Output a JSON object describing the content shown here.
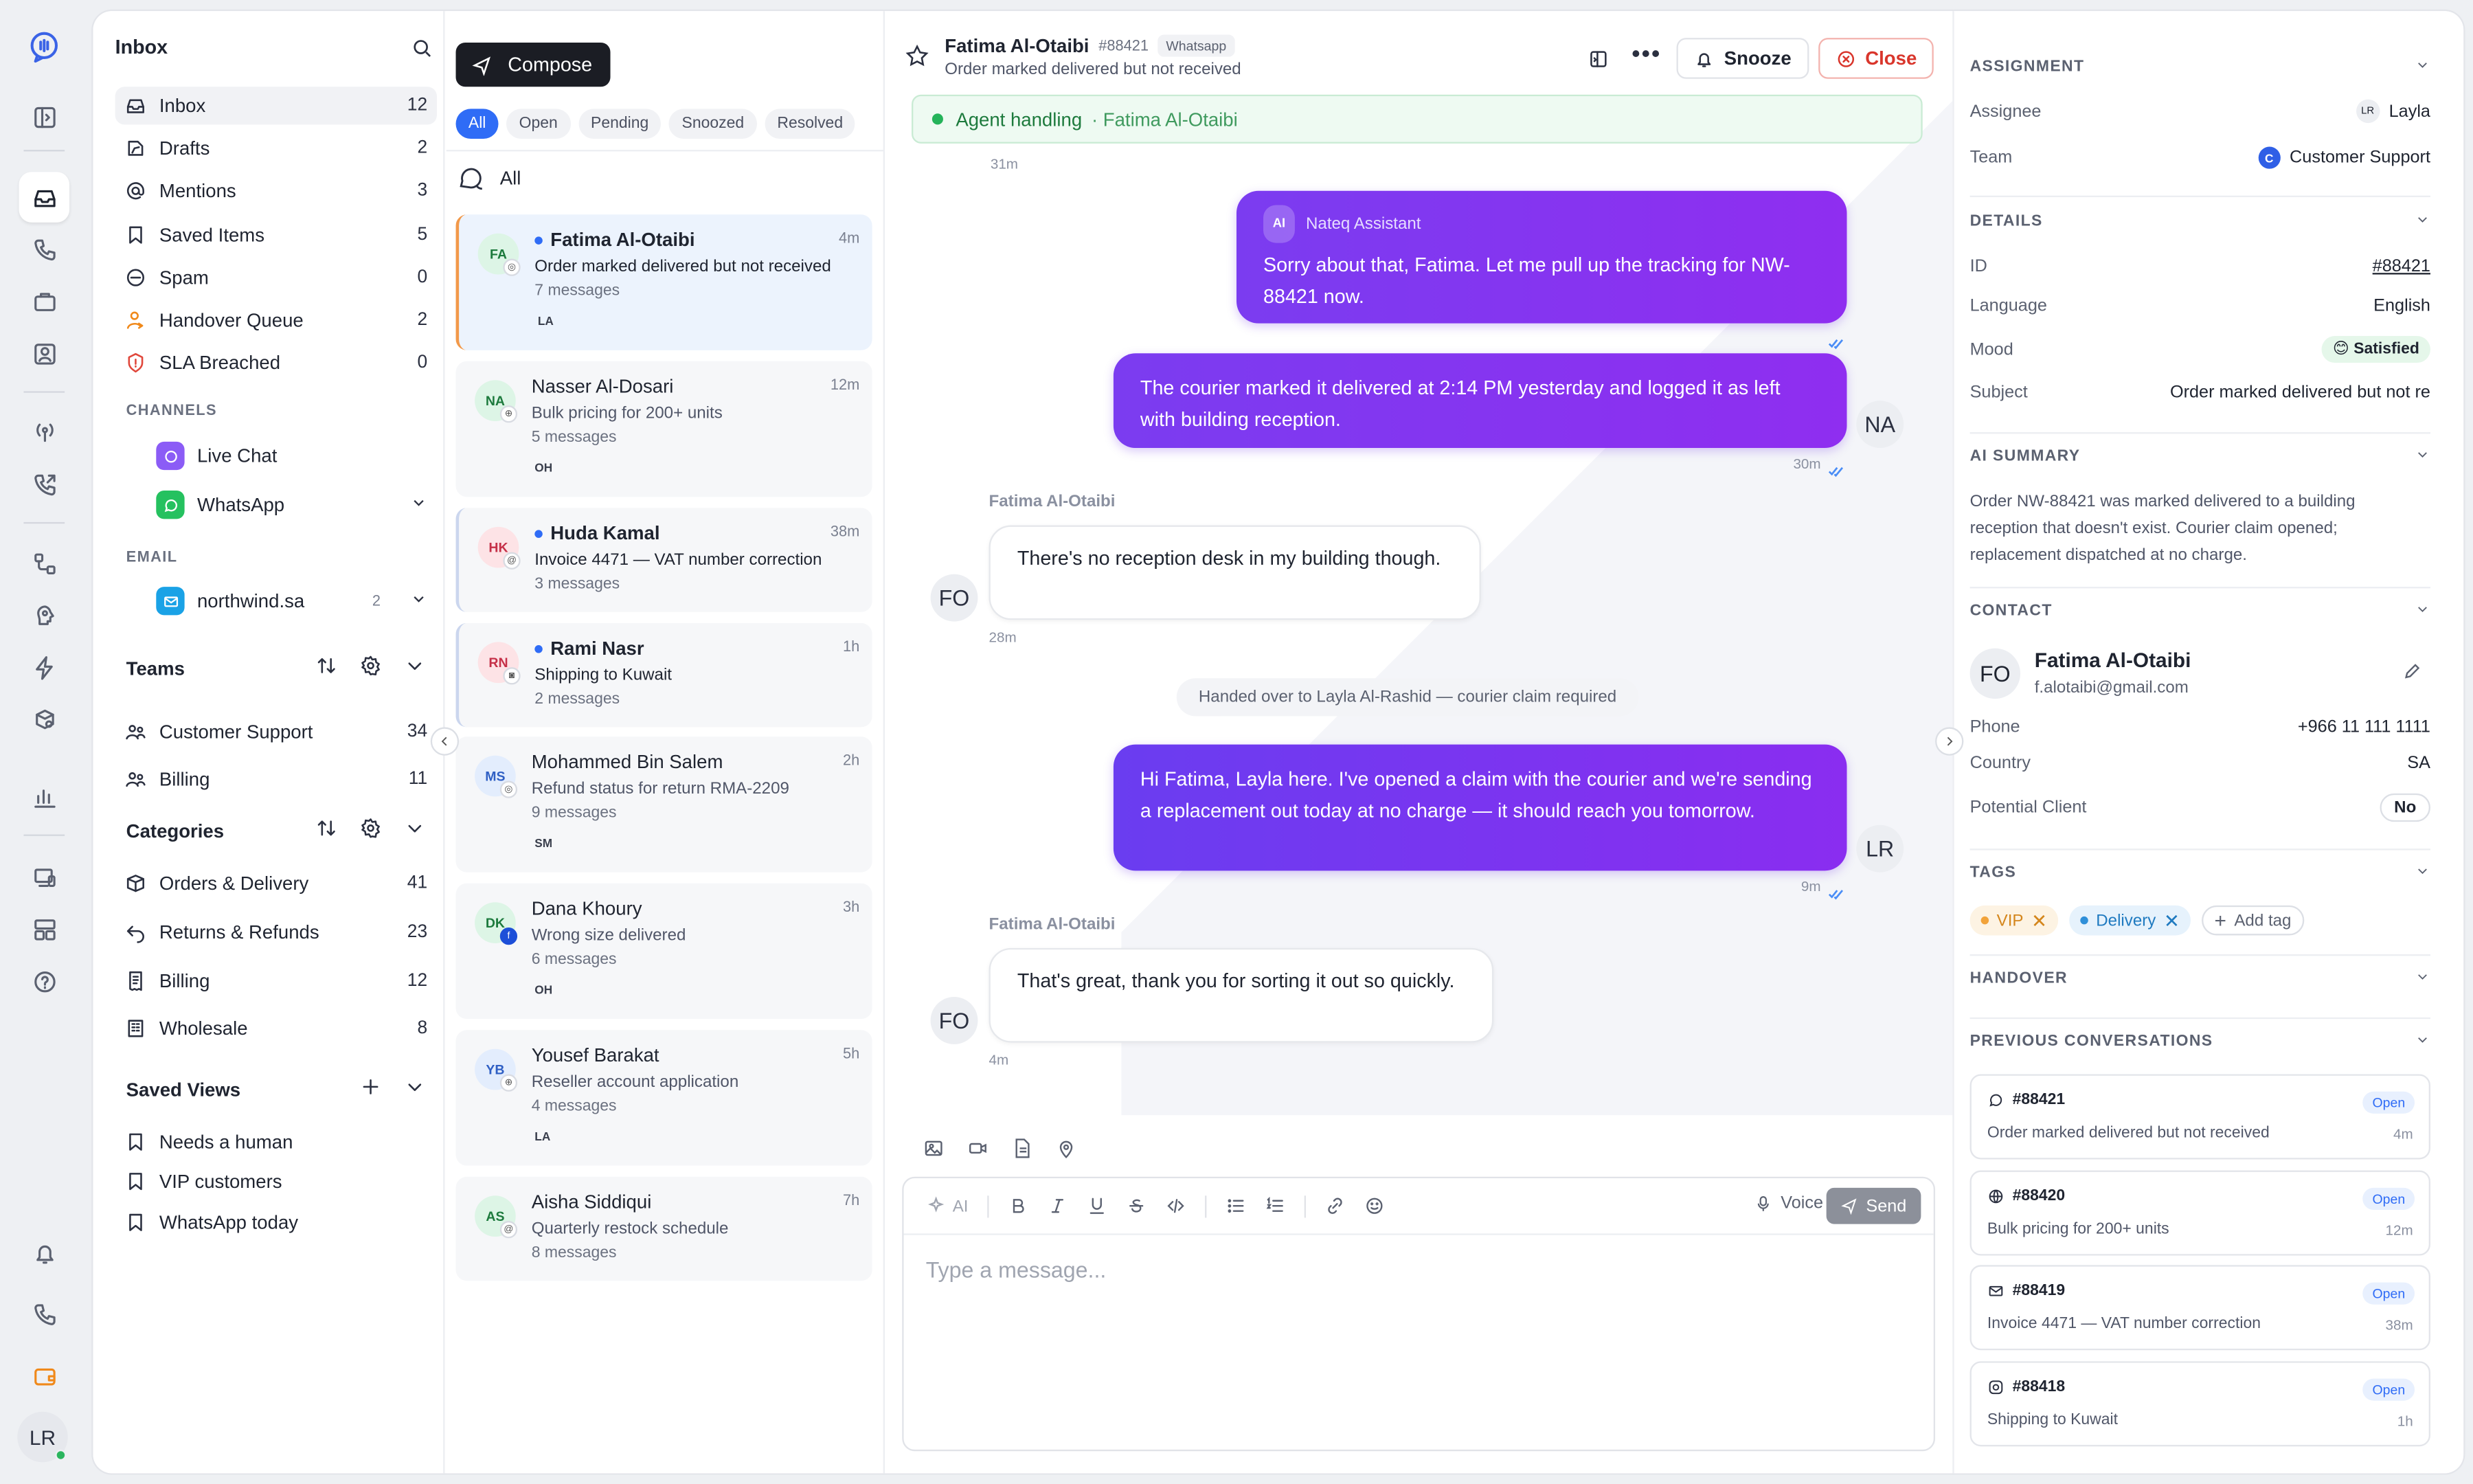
{
  "rail": {
    "avatar": "LR"
  },
  "sidebar": {
    "title": "Inbox",
    "items": [
      {
        "label": "Inbox",
        "count": "12"
      },
      {
        "label": "Drafts",
        "count": "2"
      },
      {
        "label": "Mentions",
        "count": "3"
      },
      {
        "label": "Saved Items",
        "count": "5"
      },
      {
        "label": "Spam",
        "count": "0"
      },
      {
        "label": "Handover Queue",
        "count": "2"
      },
      {
        "label": "SLA Breached",
        "count": "0"
      }
    ],
    "channels_title": "CHANNELS",
    "channels": [
      {
        "label": "Live Chat"
      },
      {
        "label": "WhatsApp"
      }
    ],
    "email_title": "EMAIL",
    "email": {
      "label": "northwind.sa",
      "count": "2"
    },
    "teams_title": "Teams",
    "teams": [
      {
        "label": "Customer Support",
        "count": "34"
      },
      {
        "label": "Billing",
        "count": "11"
      }
    ],
    "categories_title": "Categories",
    "categories": [
      {
        "label": "Orders & Delivery",
        "count": "41"
      },
      {
        "label": "Returns & Refunds",
        "count": "23"
      },
      {
        "label": "Billing",
        "count": "12"
      },
      {
        "label": "Wholesale",
        "count": "8"
      }
    ],
    "views_title": "Saved Views",
    "views": [
      {
        "label": "Needs a human"
      },
      {
        "label": "VIP customers"
      },
      {
        "label": "WhatsApp today"
      }
    ]
  },
  "list": {
    "compose": "Compose",
    "filters": [
      "All",
      "Open",
      "Pending",
      "Snoozed",
      "Resolved"
    ],
    "all_label": "All",
    "conversations": [
      {
        "initials": "FA",
        "name": "Fatima Al-Otaibi",
        "time": "4m",
        "subject": "Order marked delivered but not received",
        "messages": "7 messages",
        "assignee": "LA"
      },
      {
        "initials": "NA",
        "name": "Nasser Al-Dosari",
        "time": "12m",
        "subject": "Bulk pricing for 200+ units",
        "messages": "5 messages",
        "assignee": "OH"
      },
      {
        "initials": "HK",
        "name": "Huda Kamal",
        "time": "38m",
        "subject": "Invoice 4471 — VAT number correction",
        "messages": "3 messages",
        "assignee": ""
      },
      {
        "initials": "RN",
        "name": "Rami Nasr",
        "time": "1h",
        "subject": "Shipping to Kuwait",
        "messages": "2 messages",
        "assignee": ""
      },
      {
        "initials": "MS",
        "name": "Mohammed Bin Salem",
        "time": "2h",
        "subject": "Refund status for return RMA-2209",
        "messages": "9 messages",
        "assignee": "SM"
      },
      {
        "initials": "DK",
        "name": "Dana Khoury",
        "time": "3h",
        "subject": "Wrong size delivered",
        "messages": "6 messages",
        "assignee": "OH"
      },
      {
        "initials": "YB",
        "name": "Yousef Barakat",
        "time": "5h",
        "subject": "Reseller account application",
        "messages": "4 messages",
        "assignee": "LA"
      },
      {
        "initials": "AS",
        "name": "Aisha Siddiqui",
        "time": "7h",
        "subject": "Quarterly restock schedule",
        "messages": "8 messages",
        "assignee": ""
      }
    ]
  },
  "conversation": {
    "name": "Fatima Al-Otaibi",
    "id": "#88421",
    "channel": "Whatsapp",
    "subject": "Order marked delivered but not received",
    "snooze": "Snooze",
    "close": "Close",
    "agent_status": "Agent handling",
    "agent_name": "· Fatima Al-Otaibi",
    "messages": {
      "t0": "31m",
      "ai_label": "Nateq Assistant",
      "ai_pill": "AI",
      "ai_text": "Sorry about that, Fatima. Let me pull up the tracking for NW-88421 now.",
      "m2_text": "The courier marked it delivered at 2:14 PM yesterday and logged it as left with building reception.",
      "m2_avatar": "NA",
      "m2_time": "30m",
      "in1_sender": "Fatima Al-Otaibi",
      "in1_text": "There's no reception desk in my building though.",
      "in1_avatar": "FO",
      "in1_time": "28m",
      "system": "Handed over to Layla Al-Rashid — courier claim required",
      "m3_text": "Hi Fatima, Layla here. I've opened a claim with the courier and we're sending a replacement out today at no charge — it should reach you tomorrow.",
      "m3_avatar": "LR",
      "m3_time": "9m",
      "in2_sender": "Fatima Al-Otaibi",
      "in2_text": "That's great, thank you for sorting it out so quickly.",
      "in2_avatar": "FO",
      "in2_time": "4m"
    },
    "composer": {
      "ai": "AI",
      "voice": "Voice",
      "send": "Send",
      "placeholder": "Type a message..."
    }
  },
  "details": {
    "assignment_title": "ASSIGNMENT",
    "assignee_label": "Assignee",
    "assignee_initials": "LR",
    "assignee": "Layla",
    "team_label": "Team",
    "team_badge": "C",
    "team": "Customer Support",
    "details_title": "DETAILS",
    "id_label": "ID",
    "id": "#88421",
    "language_label": "Language",
    "language": "English",
    "mood_label": "Mood",
    "mood": "😊 Satisfied",
    "subject_label": "Subject",
    "subject": "Order marked delivered but not re",
    "summary_title": "AI SUMMARY",
    "summary": "Order NW-88421 was marked delivered to a building reception that doesn't exist. Courier claim opened; replacement dispatched at no charge.",
    "contact_title": "CONTACT",
    "contact_initials": "FO",
    "contact_name": "Fatima Al-Otaibi",
    "contact_email": "f.alotaibi@gmail.com",
    "phone_label": "Phone",
    "phone": "+966 11 111 1111",
    "country_label": "Country",
    "country": "SA",
    "potential_label": "Potential Client",
    "potential": "No",
    "tags_title": "TAGS",
    "tags": [
      {
        "label": "VIP",
        "color": "#f2a33a"
      },
      {
        "label": "Delivery",
        "color": "#2f8fd8"
      }
    ],
    "add_tag": "Add tag",
    "handover_title": "HANDOVER",
    "previous_title": "PREVIOUS CONVERSATIONS",
    "previous": [
      {
        "id": "#88421",
        "status": "Open",
        "subject": "Order marked delivered but not received",
        "time": "4m"
      },
      {
        "id": "#88420",
        "status": "Open",
        "subject": "Bulk pricing for 200+ units",
        "time": "12m"
      },
      {
        "id": "#88419",
        "status": "Open",
        "subject": "Invoice 4471 — VAT number correction",
        "time": "38m"
      },
      {
        "id": "#88418",
        "status": "Open",
        "subject": "Shipping to Kuwait",
        "time": "1h"
      }
    ]
  }
}
